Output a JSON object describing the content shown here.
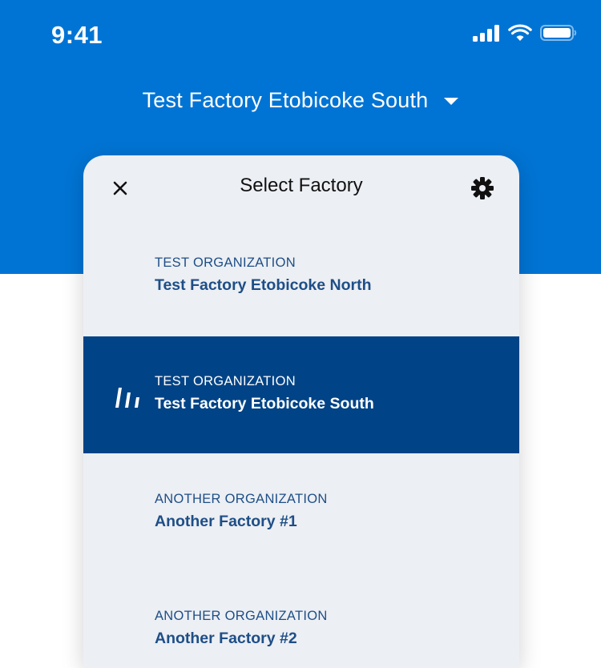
{
  "status_bar": {
    "time": "9:41",
    "icons": [
      "cellular-signal-icon",
      "wifi-icon",
      "battery-icon"
    ]
  },
  "header": {
    "title": "Test Factory Etobicoke South",
    "dropdown_icon": "caret-down-icon"
  },
  "modal": {
    "title": "Select Factory",
    "close_icon": "close-icon",
    "settings_icon": "gear-icon"
  },
  "factories": [
    {
      "organization": "TEST ORGANIZATION",
      "name": "Test Factory Etobicoke North",
      "selected": false
    },
    {
      "organization": "TEST ORGANIZATION",
      "name": "Test Factory Etobicoke South",
      "selected": true,
      "icon": "brand-logo-icon"
    },
    {
      "organization": "ANOTHER ORGANIZATION",
      "name": "Another Factory #1",
      "selected": false
    },
    {
      "organization": "ANOTHER ORGANIZATION",
      "name": "Another Factory #2",
      "selected": false
    }
  ],
  "colors": {
    "header_blue": "#0074d4",
    "selected_row": "#004386",
    "list_text": "#1e4e87",
    "modal_bg": "#eceff3"
  }
}
